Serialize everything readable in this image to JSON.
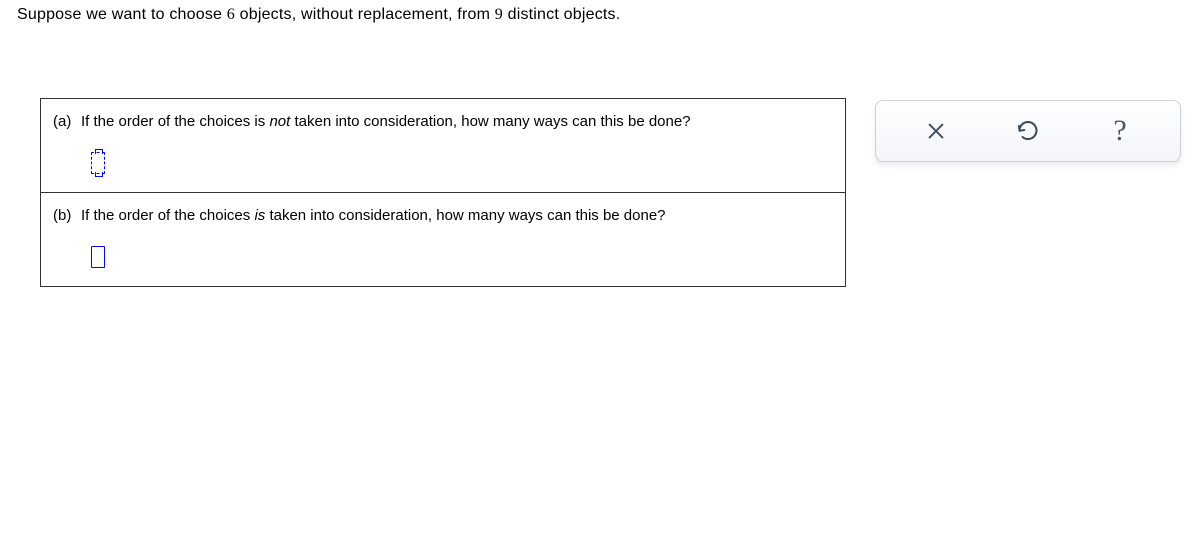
{
  "prompt": {
    "pre": "Suppose we want to choose ",
    "n1": "6",
    "mid": " objects, without replacement, from ",
    "n2": "9",
    "post": " distinct objects."
  },
  "parts": {
    "a": {
      "label": "(a)",
      "pre": "If the order of the choices is ",
      "em": "not",
      "post": " taken into consideration, how many ways can this be done?"
    },
    "b": {
      "label": "(b)",
      "pre": "If the order of the choices ",
      "em": "is",
      "post": " taken into consideration, how many ways can this be done?"
    }
  },
  "toolbar": {
    "clear": "clear",
    "reset": "reset",
    "help": "?"
  }
}
